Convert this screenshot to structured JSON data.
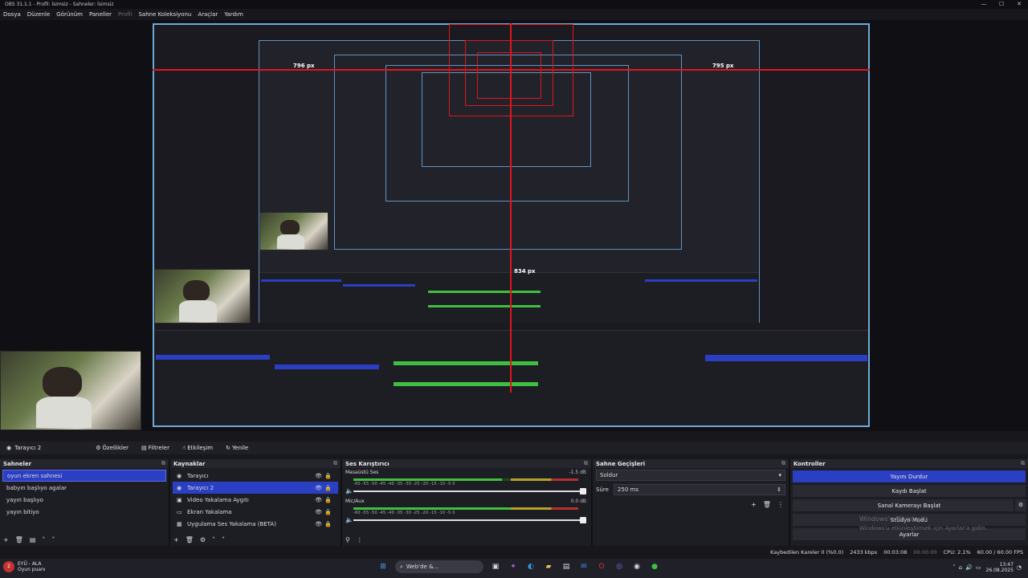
{
  "window": {
    "title": "OBS 31.1.1 - Profil: İsimsiz - Sahneler: İsimsiz",
    "controls": [
      "—",
      "☐",
      "✕"
    ]
  },
  "menu": [
    "Dosya",
    "Düzenle",
    "Görünüm",
    "Paneller",
    "Profil",
    "Sahne Koleksiyonu",
    "Araçlar",
    "Yardım"
  ],
  "preview": {
    "px_left": "796 px",
    "px_right": "795 px",
    "px_bottom": "834 px"
  },
  "source_toolbar": {
    "source_name": "Tarayıcı 2",
    "properties": "Özellikler",
    "filters": "Filtreler",
    "interact": "Etkileşim",
    "refresh": "Yenile"
  },
  "scenes": {
    "title": "Sahneler",
    "items": [
      "oyun ekren sahnesi",
      "babyın başlıyo agalar",
      "yayın başlıyo",
      "yayın bitiyo"
    ],
    "selected_index": 0
  },
  "sources": {
    "title": "Kaynaklar",
    "items": [
      {
        "label": "Tarayıcı",
        "icon": "globe-icon"
      },
      {
        "label": "Tarayıcı 2",
        "icon": "globe-icon"
      },
      {
        "label": "Video Yakalama Aygıtı",
        "icon": "camera-icon"
      },
      {
        "label": "Ekran Yakalama",
        "icon": "monitor-icon"
      },
      {
        "label": "Uygulama Ses Yakalama (BETA)",
        "icon": "audio-app-icon"
      }
    ],
    "selected_index": 1
  },
  "mixer": {
    "title": "Ses Karıştırıcı",
    "channels": [
      {
        "name": "Masaüstü Ses",
        "db": "-1.5 dB",
        "level": 0.66
      },
      {
        "name": "Mic/Aux",
        "db": "0.0 dB",
        "level": 0.7
      }
    ],
    "ticks": "-60  -55  -50  -45  -40  -35  -30  -25  -20  -15  -10  -5  0"
  },
  "transitions": {
    "title": "Sahne Geçişleri",
    "selected": "Soldur",
    "duration_label": "Süre",
    "duration_value": "250 ms"
  },
  "controls": {
    "title": "Kontroller",
    "stop_stream": "Yayını Durdur",
    "start_record": "Kaydı Başlat",
    "virtual_cam": "Sanal Kamerayı Başlat",
    "studio_mode": "Stüdyo Modu",
    "settings": "Ayarlar",
    "watermark_1": "Windows'u Etkinleştir",
    "watermark_2": "Windows'u etkinleştirmek için Ayarlar'a gidin."
  },
  "statusbar": {
    "dropped": "Kaybedilen Kareler 0 (%0.0)",
    "kbps": "2433 kbps",
    "stream_time": "00:03:08",
    "rec_time": "00:00:00",
    "cpu": "CPU: 2.1%",
    "fps": "60.00 / 60.00 FPS"
  },
  "taskbar": {
    "app_name": "EYÜ - ALA",
    "app_sub": "Oyun puanı",
    "search": "Web'de &...",
    "time": "13:47",
    "date": "26.08.2025"
  },
  "colors": {
    "accent": "#2b3fc2",
    "guide": "#e0161b",
    "frame": "#6fa9d8",
    "meter_green": "#3fbf3f",
    "meter_yellow": "#b6a12a",
    "meter_red": "#b53030"
  }
}
